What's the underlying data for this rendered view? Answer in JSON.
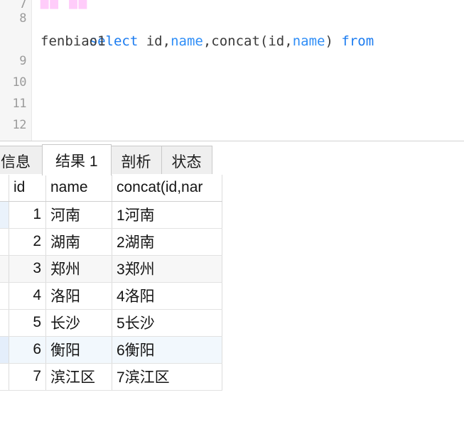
{
  "editor": {
    "gutter_lines": [
      "7",
      "8",
      "9",
      "10",
      "11",
      "12"
    ],
    "line7_fragment": "██ ██",
    "statement_tokens": [
      {
        "text": "select ",
        "kind": "keyword"
      },
      {
        "text": "id",
        "kind": "identifier"
      },
      {
        "text": ",",
        "kind": "identifier"
      },
      {
        "text": "name",
        "kind": "column"
      },
      {
        "text": ",",
        "kind": "identifier"
      },
      {
        "text": "concat(",
        "kind": "identifier"
      },
      {
        "text": "id",
        "kind": "identifier"
      },
      {
        "text": ",",
        "kind": "identifier"
      },
      {
        "text": "name",
        "kind": "column"
      },
      {
        "text": ")",
        "kind": "identifier"
      },
      {
        "text": " ",
        "kind": "identifier"
      },
      {
        "text": "from",
        "kind": "keyword"
      }
    ],
    "statement_line1": "select id,name,concat(id,name) from",
    "statement_line2": "fenbiao1",
    "table_name": "fenbiao1"
  },
  "tabs": [
    {
      "label": "信息",
      "active": false,
      "clipped": true
    },
    {
      "label": "结果 1",
      "active": true,
      "clipped": false
    },
    {
      "label": "剖析",
      "active": false,
      "clipped": false
    },
    {
      "label": "状态",
      "active": false,
      "clipped": false
    }
  ],
  "result_grid": {
    "columns": [
      "id",
      "name",
      "concat(id,name)"
    ],
    "column_display": [
      "id",
      "name",
      "concat(id,nar"
    ],
    "rows": [
      {
        "id": "1",
        "name": "河南",
        "concat": "1河南"
      },
      {
        "id": "2",
        "name": "湖南",
        "concat": "2湖南"
      },
      {
        "id": "3",
        "name": "郑州",
        "concat": "3郑州"
      },
      {
        "id": "4",
        "name": "洛阳",
        "concat": "4洛阳"
      },
      {
        "id": "5",
        "name": "长沙",
        "concat": "5长沙"
      },
      {
        "id": "6",
        "name": "衡阳",
        "concat": "6衡阳"
      },
      {
        "id": "7",
        "name": "滨江区",
        "concat": "7滨江区"
      }
    ],
    "selected_row_index": 5,
    "striped_row_indices": [
      2
    ],
    "selected_column": "id"
  },
  "colors": {
    "keyword": "#1a7bf0",
    "column_token": "#2f8ef7",
    "identifier": "#3a3a3a",
    "gutter_bg": "#f6f6f6",
    "gutter_text": "#9b9b9b",
    "header_selected_bg": "#dbe8f7",
    "row_selected_bg": "#f2f8fd",
    "row_stripe_bg": "#f7f7f7",
    "tab_inactive_bg": "#efefef",
    "tab_active_bg": "#ffffff",
    "grid_border": "#dcdcdc"
  }
}
